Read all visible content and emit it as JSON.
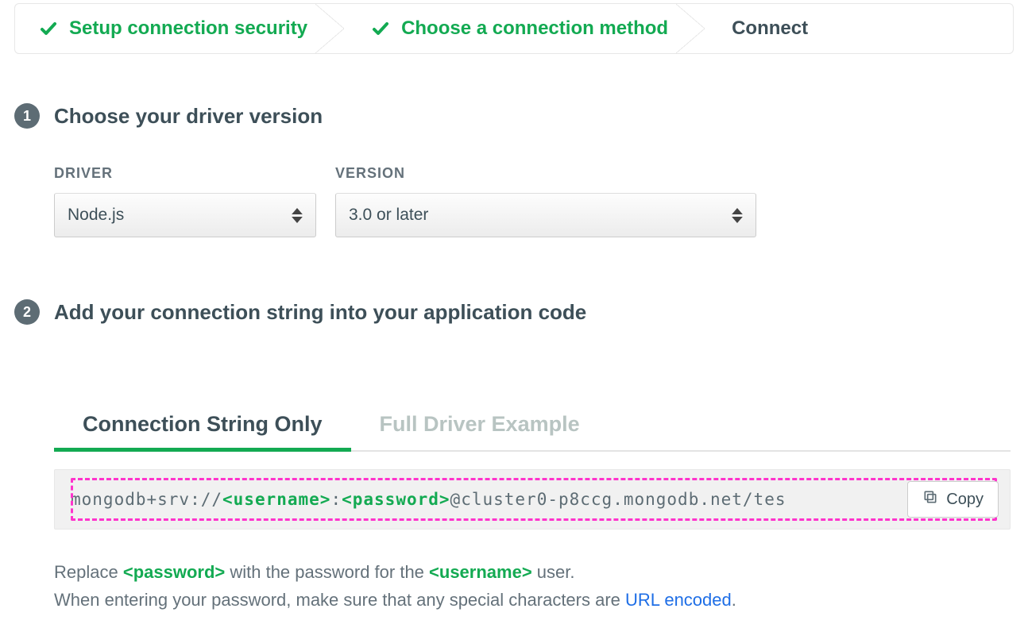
{
  "stepper": {
    "step1": "Setup connection security",
    "step2": "Choose a connection method",
    "step3": "Connect"
  },
  "section1": {
    "num": "1",
    "title": "Choose your driver version",
    "driver_label": "DRIVER",
    "driver_value": "Node.js",
    "version_label": "VERSION",
    "version_value": "3.0 or later"
  },
  "section2": {
    "num": "2",
    "title": "Add your connection string into your application code",
    "tabs": {
      "t1": "Connection String Only",
      "t2": "Full Driver Example"
    },
    "conn": {
      "prefix": "mongodb+srv://",
      "user_ph": "<username>",
      "colon": ":",
      "pass_ph": "<password>",
      "suffix": "@cluster0-p8ccg.mongodb.net/tes"
    },
    "copy_label": "Copy",
    "help": {
      "l1a": "Replace ",
      "l1b": "<password>",
      "l1c": " with the password for the ",
      "l1d": "<username>",
      "l1e": " user.",
      "l2a": "When entering your password, make sure that any special characters are ",
      "l2b": "URL encoded",
      "l2c": "."
    }
  }
}
